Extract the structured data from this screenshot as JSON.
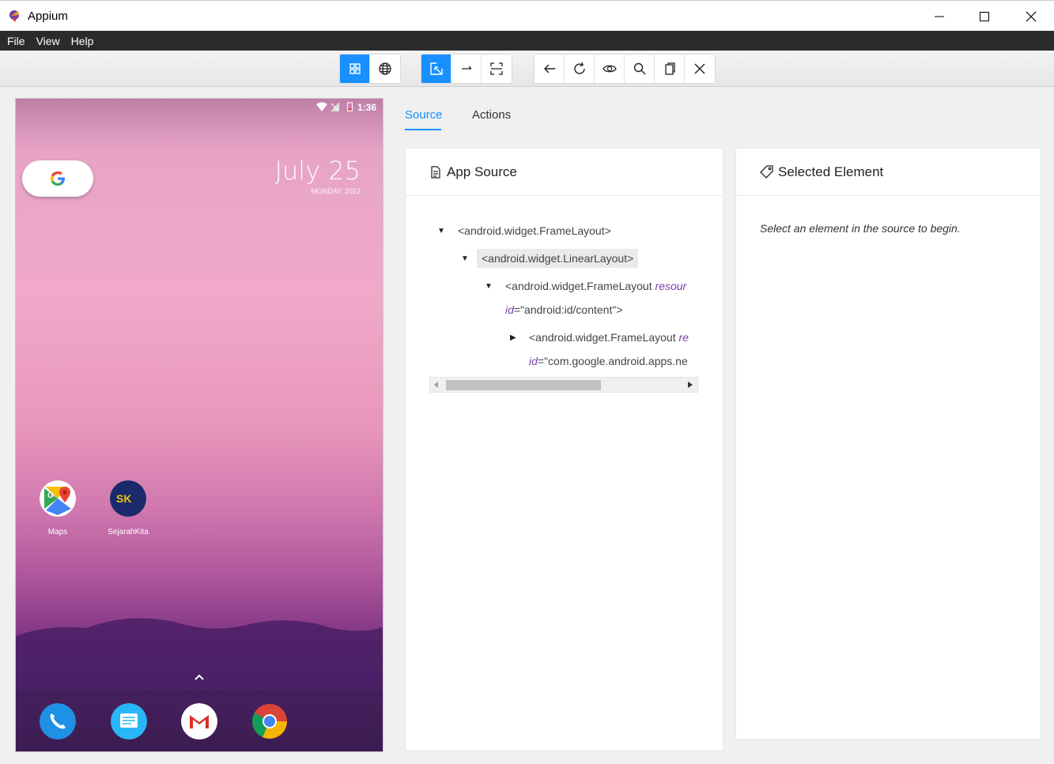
{
  "window": {
    "title": "Appium"
  },
  "menu": [
    "File",
    "View",
    "Help"
  ],
  "toolbar": {
    "groups": [
      [
        "grid-icon",
        "globe-icon"
      ],
      [
        "select-element-icon",
        "swipe-icon",
        "tap-coordinates-icon"
      ],
      [
        "back-icon",
        "refresh-icon",
        "eye-icon",
        "search-icon",
        "copy-icon",
        "close-icon"
      ]
    ]
  },
  "device": {
    "time": "1:36",
    "date": "July 25",
    "day": "MONDAY, 2022",
    "apps": [
      {
        "label": "Maps"
      },
      {
        "label": "SejarahKita"
      }
    ],
    "dock": [
      "phone",
      "messages",
      "gmail",
      "chrome"
    ]
  },
  "tabs": {
    "source": "Source",
    "actions": "Actions"
  },
  "source_panel": {
    "title": "App Source",
    "nodes": {
      "n1": "<android.widget.FrameLayout>",
      "n2": "<android.widget.LinearLayout>",
      "n3_tag": "<android.widget.FrameLayout ",
      "n3_attr": "resour",
      "n3_attr2": "id",
      "n3_val": "=\"android:id/content\">",
      "n4_tag": "<android.widget.FrameLayout ",
      "n4_attr": "re",
      "n4_attr2": "id",
      "n4_val": "=\"com.google.android.apps.ne"
    }
  },
  "selected_panel": {
    "title": "Selected Element",
    "hint": "Select an element in the source to begin."
  },
  "colors": {
    "accent": "#1890ff",
    "menubar": "#2b2b2b"
  }
}
